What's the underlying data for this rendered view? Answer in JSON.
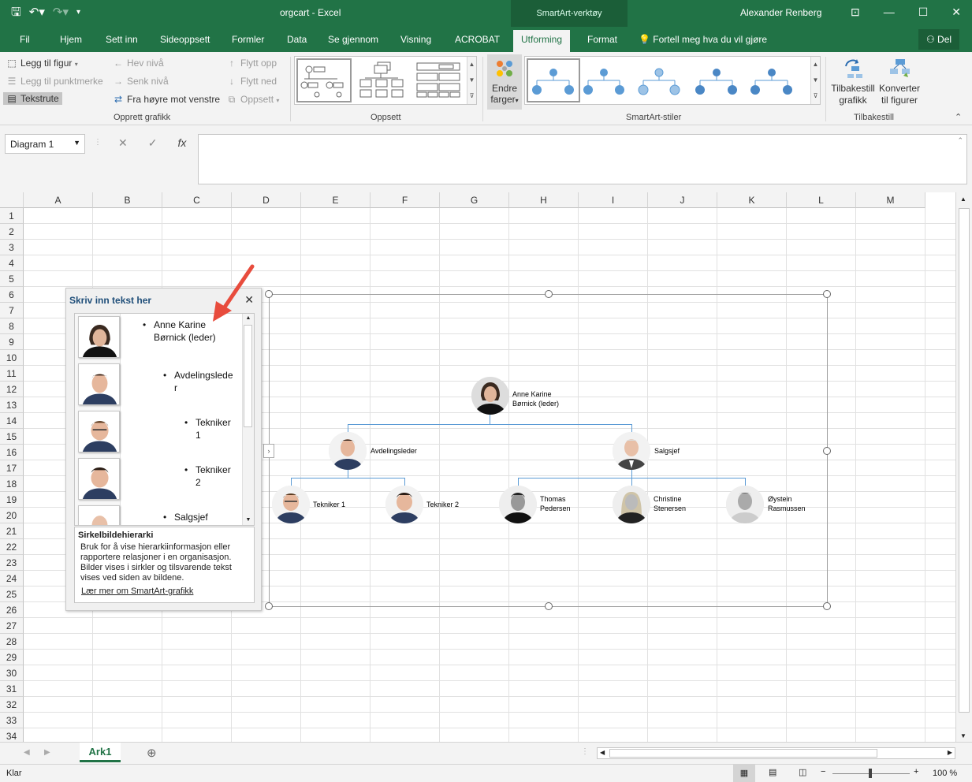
{
  "window": {
    "doc_title": "orgcart - Excel",
    "context_tab_group": "SmartArt-verktøy",
    "user_name": "Alexander Renberg"
  },
  "tabs": [
    "Fil",
    "Hjem",
    "Sett inn",
    "Sideoppsett",
    "Formler",
    "Data",
    "Se gjennom",
    "Visning",
    "ACROBAT",
    "Utforming",
    "Format"
  ],
  "active_tab": "Utforming",
  "tell_me": "Fortell meg hva du vil gjøre",
  "share": "Del",
  "ribbon": {
    "create": {
      "add_shape": "Legg til figur",
      "add_bullet": "Legg til punktmerke",
      "text_pane": "Tekstrute",
      "promote": "Hev nivå",
      "demote": "Senk nivå",
      "rtl": "Fra høyre mot venstre",
      "move_up": "Flytt opp",
      "move_down": "Flytt ned",
      "layout": "Oppsett",
      "label": "Opprett grafikk"
    },
    "layouts_label": "Oppsett",
    "change_colors": [
      "Endre",
      "farger"
    ],
    "styles_label": "SmartArt-stiler",
    "reset": {
      "reset_graphic": [
        "Tilbakestill",
        "grafikk"
      ],
      "convert": [
        "Konverter",
        "til figurer"
      ],
      "label": "Tilbakestill"
    }
  },
  "formula_bar": {
    "name_box": "Diagram 1",
    "fx": "fx"
  },
  "columns": [
    "A",
    "B",
    "C",
    "D",
    "E",
    "F",
    "G",
    "H",
    "I",
    "J",
    "K",
    "L",
    "M"
  ],
  "rows": [
    "1",
    "2",
    "3",
    "4",
    "5",
    "6",
    "7",
    "8",
    "9",
    "10",
    "11",
    "12",
    "13",
    "14",
    "15",
    "16",
    "17",
    "18",
    "19",
    "20",
    "21",
    "22",
    "23",
    "24",
    "25",
    "26",
    "27",
    "28",
    "29",
    "30",
    "31",
    "32",
    "33",
    "34"
  ],
  "text_pane": {
    "title": "Skriv inn tekst her",
    "items": [
      {
        "line1": "Anne Karine",
        "line2": "Børnick (leder)"
      },
      {
        "line1": "Avdelingslede",
        "line2": "r"
      },
      {
        "line1": "Tekniker",
        "line2": "1"
      },
      {
        "line1": "Tekniker",
        "line2": "2"
      },
      {
        "line1": "Salgsjef",
        "line2": ""
      }
    ],
    "desc_title": "Sirkelbildehierarki",
    "desc_lines": [
      "Bruk for å vise hierarkiinformasjon eller",
      "rapportere relasjoner i en organisasjon.",
      "Bilder vises i sirkler og tilsvarende tekst",
      "vises ved siden av bildene."
    ],
    "learn_more": "Lær mer om SmartArt-grafikk"
  },
  "org_chart": {
    "root": {
      "line1": "Anne Karine",
      "line2": "Børnick (leder)"
    },
    "level2": [
      {
        "line1": "Avdelingsleder",
        "line2": ""
      },
      {
        "line1": "Salgsjef",
        "line2": ""
      }
    ],
    "level3": [
      {
        "line1": "Tekniker 1",
        "line2": ""
      },
      {
        "line1": "Tekniker 2",
        "line2": ""
      },
      {
        "line1": "Thomas",
        "line2": "Pedersen"
      },
      {
        "line1": "Christine",
        "line2": "Stenersen"
      },
      {
        "line1": "Øystein",
        "line2": "Rasmussen"
      }
    ]
  },
  "sheet_tab": "Ark1",
  "status": {
    "ready": "Klar",
    "zoom": "100 %"
  },
  "colors": {
    "excel_green": "#217346",
    "connector": "#5b9bd5",
    "annotation_arrow": "#e84c3d"
  }
}
